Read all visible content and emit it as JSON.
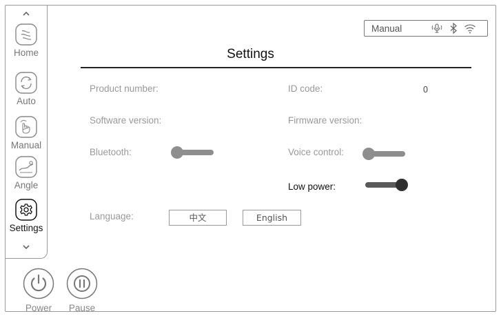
{
  "status": {
    "mode": "Manual"
  },
  "page_title": "Settings",
  "sidebar": {
    "items": [
      {
        "label": "Home"
      },
      {
        "label": "Auto"
      },
      {
        "label": "Manual"
      },
      {
        "label": "Angle"
      },
      {
        "label": "Settings",
        "active": true
      }
    ]
  },
  "settings": {
    "product_number_label": "Product number:",
    "id_code_label": "ID code:",
    "id_code_value": "0",
    "software_version_label": "Software version:",
    "firmware_version_label": "Firmware version:",
    "bluetooth_label": "Bluetooth:",
    "bluetooth_on": false,
    "voice_control_label": "Voice control:",
    "voice_control_on": false,
    "low_power_label": "Low power:",
    "low_power_on": true,
    "language_label": "Language:",
    "language_options": [
      "中文",
      "English"
    ]
  },
  "controls": {
    "power_label": "Power",
    "pause_label": "Pause"
  },
  "colors": {
    "accent": "#2f2f2f",
    "muted": "#999999"
  }
}
